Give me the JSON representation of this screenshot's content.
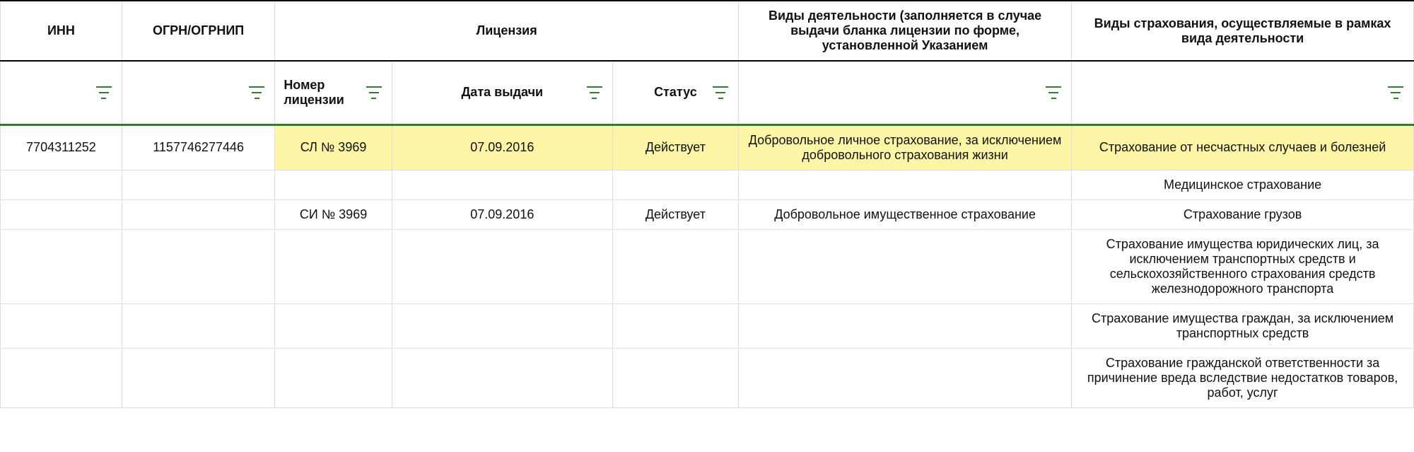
{
  "headers": {
    "inn": "ИНН",
    "ogrn": "ОГРН/ОГРНИП",
    "license": "Лицензия",
    "activity": "Виды деятельности (заполняется в случае выдачи бланка лицензии по форме, установленной Указанием",
    "insurance": "Виды страхования, осуществляемые в рамках вида деятельности"
  },
  "subheaders": {
    "license_number": "Номер лицензии",
    "issue_date": "Дата выдачи",
    "status": "Статус"
  },
  "rows": [
    {
      "inn": "7704311252",
      "ogrn": "1157746277446",
      "license_number": "СЛ № 3969",
      "issue_date": "07.09.2016",
      "status": "Действует",
      "activity": "Добровольное личное страхование, за исключением добровольного страхования жизни",
      "insurance": "Страхование от несчастных случаев и болезней",
      "highlight": true
    },
    {
      "inn": "",
      "ogrn": "",
      "license_number": "",
      "issue_date": "",
      "status": "",
      "activity": "",
      "insurance": "Медицинское страхование",
      "highlight": false
    },
    {
      "inn": "",
      "ogrn": "",
      "license_number": "СИ № 3969",
      "issue_date": "07.09.2016",
      "status": "Действует",
      "activity": "Добровольное имущественное страхование",
      "insurance": "Страхование грузов",
      "highlight": false
    },
    {
      "inn": "",
      "ogrn": "",
      "license_number": "",
      "issue_date": "",
      "status": "",
      "activity": "",
      "insurance": "Страхование имущества юридических лиц, за исключением транспортных средств и сельскохозяйственного страхования средств железнодорожного транспорта",
      "highlight": false
    },
    {
      "inn": "",
      "ogrn": "",
      "license_number": "",
      "issue_date": "",
      "status": "",
      "activity": "",
      "insurance": "Страхование имущества граждан, за исключением транспортных средств",
      "highlight": false
    },
    {
      "inn": "",
      "ogrn": "",
      "license_number": "",
      "issue_date": "",
      "status": "",
      "activity": "",
      "insurance": "Страхование гражданской ответственности за причинение вреда вследствие недостатков товаров, работ, услуг",
      "highlight": false
    }
  ]
}
